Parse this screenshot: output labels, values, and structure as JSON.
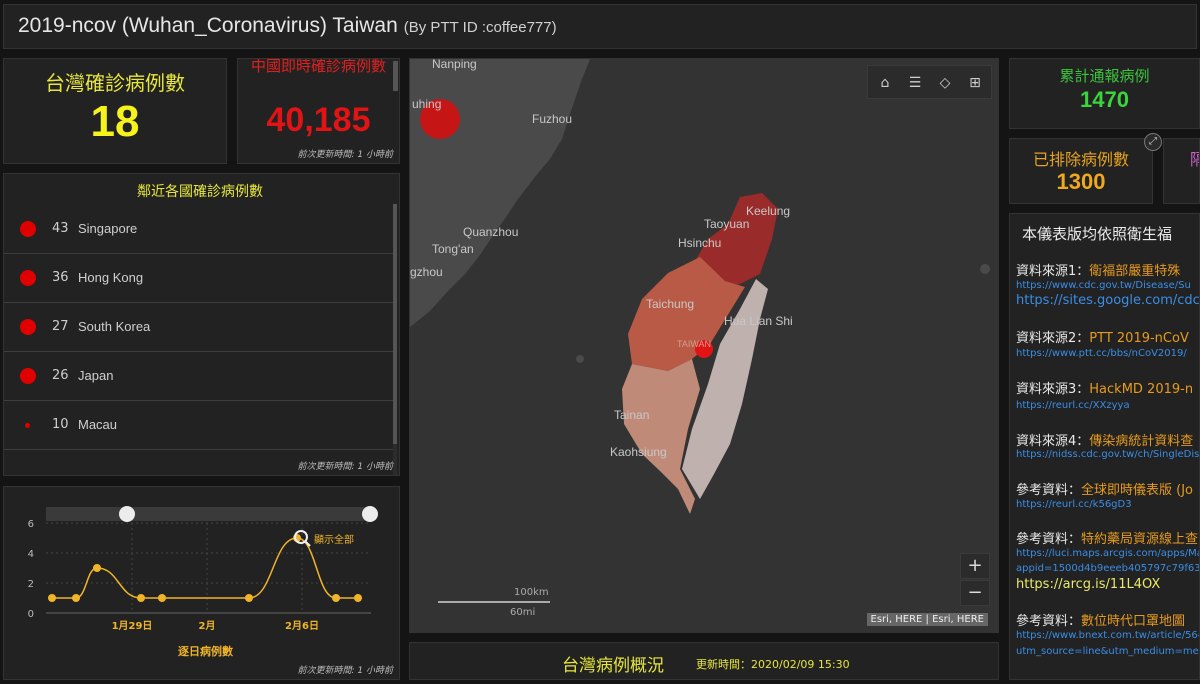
{
  "header": {
    "title": "2019-ncov (Wuhan_Coronavirus) Taiwan",
    "subtitle": "(By PTT ID :coffee777)"
  },
  "taiwan_confirmed": {
    "label": "台灣確診病例數",
    "value": "18"
  },
  "china_confirmed": {
    "label": "中國即時確診病例數",
    "value": "40,185",
    "update": "前次更新時間: 1 小時前"
  },
  "reported": {
    "label": "累計通報病例",
    "value": "1470"
  },
  "excluded": {
    "label": "已排除病例數",
    "value": "1300"
  },
  "partial_right": {
    "label": "隔"
  },
  "neighbors": {
    "title": "鄰近各國確診病例數",
    "update": "前次更新時間: 1 小時前",
    "items": [
      {
        "count": "43",
        "name": "Singapore"
      },
      {
        "count": "36",
        "name": "Hong Kong"
      },
      {
        "count": "27",
        "name": "South Korea"
      },
      {
        "count": "26",
        "name": "Japan"
      },
      {
        "count": "10",
        "name": "Macau"
      }
    ]
  },
  "daily_chart": {
    "xlabel": "逐日病例數",
    "show_all": "顯示全部",
    "update": "前次更新時間: 1 小時前"
  },
  "chart_data": {
    "type": "line",
    "title": "",
    "xlabel": "逐日病例數",
    "ylabel": "",
    "ylim": [
      0,
      6
    ],
    "yticks": [
      "0",
      "2",
      "4",
      "6"
    ],
    "xticks": [
      "1月29日",
      "2月",
      "2月6日"
    ],
    "series": [
      {
        "values": [
          1,
          1,
          3,
          1,
          1,
          1,
          5,
          1,
          1
        ]
      }
    ],
    "color": "#f0b429"
  },
  "map": {
    "labels": {
      "nanping": "Nanping",
      "wuhan": "uhing",
      "fuzhou": "Fuzhou",
      "keelung": "Keelung",
      "taoyuan": "Taoyuan",
      "hsinchu": "Hsinchu",
      "quanzhou": "Quanzhou",
      "tongan": "Tong'an",
      "zhou": "gzhou",
      "taichung": "Taichung",
      "hualien": "Hua Lian Shi",
      "taiwan": "TAIWAN",
      "tainan": "Tainan",
      "kaohsiung": "Kaohsiung"
    },
    "scale_km": "100km",
    "scale_mi": "60mi",
    "attribution": "Esri, HERE | Esri, HERE",
    "zoom_in": "+",
    "zoom_out": "−"
  },
  "summary_bar": {
    "title": "台灣病例概況",
    "updated_label": "更新時間：",
    "updated_time": "2020/02/09 15:30"
  },
  "sources": {
    "intro": "本儀表版均依照衛生福",
    "items": [
      {
        "label": "資料來源1：",
        "title": "衛福部嚴重特殊",
        "link": "https://www.cdc.gov.tw/Disease/Su",
        "link2": "https://sites.google.com/cdc.g"
      },
      {
        "label": "資料來源2：",
        "title": "PTT 2019-nCoV",
        "link": "https://www.ptt.cc/bbs/nCoV2019/"
      },
      {
        "label": "資料來源3：",
        "title": "HackMD 2019-n",
        "link": "https://reurl.cc/XXzyya"
      },
      {
        "label": "資料來源4：",
        "title": "傳染病統計資料查",
        "link": "https://nidss.cdc.gov.tw/ch/SingleDisea"
      },
      {
        "label": "參考資料：",
        "title": "全球即時儀表版 (Jo",
        "link": "https://reurl.cc/k56gD3"
      },
      {
        "label": "參考資料：",
        "title": "特約藥局資源線上查",
        "link": "https://luci.maps.arcgis.com/apps/Map",
        "link2": "appid=1500d4b9eeeb405797c79f63b",
        "link3": "https://arcg.is/11L4OX"
      },
      {
        "label": "參考資料：",
        "title": "數位時代口罩地圖",
        "link": "https://www.bnext.com.tw/article/56482/fi",
        "link2": "utm_source=line&utm_medium=message"
      }
    ]
  }
}
